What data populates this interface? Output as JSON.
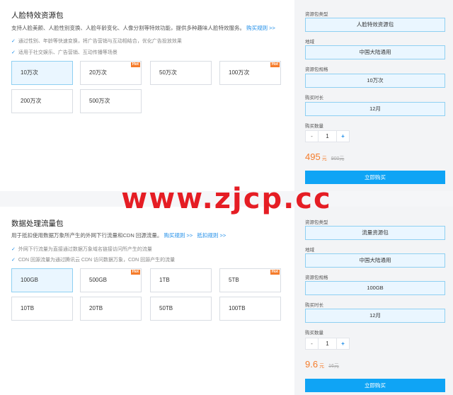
{
  "pack1": {
    "title": "人脸特效资源包",
    "desc": "支持人脸美颜、人脸性别变换、人脸年龄变化、人像分割等特效功能，提供多种趣味人脸特效服务。",
    "desc_link": "购买规则 >>",
    "features": [
      "通过性别、年龄等快速变换，将广告营销与互动相结合，优化广告投放效果",
      "适用于社交娱乐、广告营销、互动传播等场景"
    ],
    "options": [
      {
        "label": "10万次",
        "selected": true,
        "hot": false
      },
      {
        "label": "20万次",
        "selected": false,
        "hot": true
      },
      {
        "label": "50万次",
        "selected": false,
        "hot": false
      },
      {
        "label": "100万次",
        "selected": false,
        "hot": true
      },
      {
        "label": "200万次",
        "selected": false,
        "hot": false
      },
      {
        "label": "500万次",
        "selected": false,
        "hot": false
      }
    ],
    "hot_label": "Hot",
    "panel": {
      "type_label": "资源包类型",
      "type_value": "人脸特效资源包",
      "region_label": "地域",
      "region_value": "中国大陆通用",
      "spec_label": "资源包规格",
      "spec_value": "10万次",
      "duration_label": "购买时长",
      "duration_value": "12月",
      "qty_label": "购买数量",
      "qty_minus": "-",
      "qty_value": "1",
      "qty_plus": "+",
      "price": "495",
      "price_unit": "元",
      "price_orig": "900元",
      "buy_label": "立即购买"
    }
  },
  "pack2": {
    "title": "数据处理流量包",
    "desc": "用于抵扣使用数据万象所产生的外网下行流量和CDN 回源流量。",
    "desc_link1": "购买规则 >>",
    "desc_link2": "抵扣规则 >>",
    "features": [
      "外网下行流量为直接通过数据万象域名链接访问所产生的流量",
      "CDN 回源流量为通过腾讯云 CDN 访问数据万象，CDN 回源产生的流量"
    ],
    "options": [
      {
        "label": "100GB",
        "selected": true,
        "hot": false
      },
      {
        "label": "500GB",
        "selected": false,
        "hot": true
      },
      {
        "label": "1TB",
        "selected": false,
        "hot": false
      },
      {
        "label": "5TB",
        "selected": false,
        "hot": true
      },
      {
        "label": "10TB",
        "selected": false,
        "hot": false
      },
      {
        "label": "20TB",
        "selected": false,
        "hot": false
      },
      {
        "label": "50TB",
        "selected": false,
        "hot": false
      },
      {
        "label": "100TB",
        "selected": false,
        "hot": false
      }
    ],
    "hot_label": "Hot",
    "panel": {
      "type_label": "资源包类型",
      "type_value": "流量资源包",
      "region_label": "地域",
      "region_value": "中国大陆通用",
      "spec_label": "资源包规格",
      "spec_value": "100GB",
      "duration_label": "购买时长",
      "duration_value": "12月",
      "qty_label": "购买数量",
      "qty_minus": "-",
      "qty_value": "1",
      "qty_plus": "+",
      "price": "9.6",
      "price_unit": "元",
      "price_orig": "16元",
      "buy_label": "立即购买"
    }
  },
  "watermark": "www.zjcp.cc",
  "colors": {
    "accent": "#1e8de8",
    "price": "#f57c2b",
    "buy": "#0fa4f5",
    "selected_bg": "#eaf6ff",
    "hot": "#f57c2b",
    "watermark": "#e51d24"
  }
}
